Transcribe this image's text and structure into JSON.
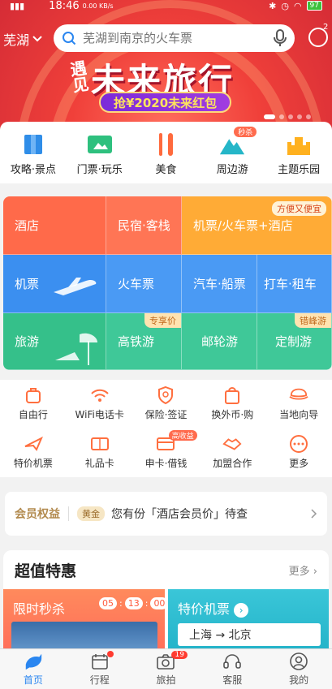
{
  "status": {
    "time": "18:46",
    "speed": "0.00 KB/s",
    "battery": "97"
  },
  "location": "芜湖",
  "search": {
    "placeholder": "芜湖到南京的火车票"
  },
  "message_badge": "2",
  "banner": {
    "tag": "遇见",
    "title": "未来旅行",
    "promo": "抢¥2020未来红包",
    "slide_count": 6,
    "active_slide": 0
  },
  "categories": [
    {
      "label": "攻略·景点",
      "icon": "guide-book-icon"
    },
    {
      "label": "门票·玩乐",
      "icon": "ticket-icon"
    },
    {
      "label": "美食",
      "icon": "food-icon"
    },
    {
      "label": "周边游",
      "icon": "mountain-icon",
      "badge": "秒杀"
    },
    {
      "label": "主题乐园",
      "icon": "castle-icon"
    }
  ],
  "grid": {
    "hotel": "酒店",
    "homestay": "民宿·客栈",
    "flight_hotel": "机票/火车票+酒店",
    "flight_hotel_tag": "方便又便宜",
    "flight": "机票",
    "train": "火车票",
    "bus_ship": "汽车·船票",
    "taxi_rental": "打车·租车",
    "tour": "旅游",
    "rail_tour": "高铁游",
    "rail_tour_tag": "专享价",
    "cruise": "邮轮游",
    "custom": "定制游",
    "custom_tag": "错峰游"
  },
  "services": [
    {
      "label": "自由行",
      "icon": "suitcase-icon"
    },
    {
      "label": "WiFi电话卡",
      "icon": "wifi-icon"
    },
    {
      "label": "保险·签证",
      "icon": "shield-icon"
    },
    {
      "label": "换外币·购",
      "icon": "shopping-bag-icon"
    },
    {
      "label": "当地向导",
      "icon": "guide-hat-icon"
    },
    {
      "label": "特价机票",
      "icon": "plane-icon"
    },
    {
      "label": "礼品卡",
      "icon": "gift-card-icon"
    },
    {
      "label": "申卡·借钱",
      "icon": "credit-card-icon",
      "badge": "高收益"
    },
    {
      "label": "加盟合作",
      "icon": "handshake-icon"
    },
    {
      "label": "更多",
      "icon": "more-icon"
    }
  ],
  "member": {
    "title": "会员权益",
    "level": "黄金",
    "text": "您有份「酒店会员价」待查"
  },
  "deals": {
    "title": "超值特惠",
    "more": "更多",
    "flash_title": "限时秒杀",
    "timer": [
      "05",
      "13",
      "00"
    ],
    "flight_title": "特价机票",
    "route": "上海 → 北京"
  },
  "tabs": [
    {
      "label": "首页",
      "icon": "home-dolphin-icon",
      "active": true
    },
    {
      "label": "行程",
      "icon": "calendar-icon"
    },
    {
      "label": "旅拍",
      "icon": "camera-icon",
      "count": "19"
    },
    {
      "label": "客服",
      "icon": "headset-icon"
    },
    {
      "label": "我的",
      "icon": "user-icon"
    }
  ],
  "colors": {
    "hotel": "#ff6a4a",
    "flight": "#3b8ff0",
    "tour": "#35c08a",
    "accent": "#2a86f0"
  }
}
